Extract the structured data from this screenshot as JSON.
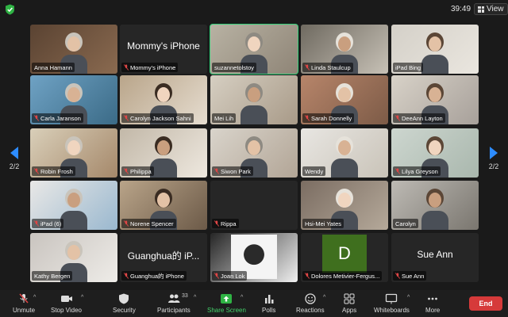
{
  "topbar": {
    "clock": "39:49",
    "view_label": "View"
  },
  "pager": {
    "left_page": "2/2",
    "right_page": "2/2"
  },
  "tiles": [
    {
      "name": "Anna Hamann",
      "muted": false
    },
    {
      "name": "Mommy's iPhone",
      "muted": true,
      "big_text": "Mommy's iPhone"
    },
    {
      "name": "suzannetolstoy",
      "muted": false,
      "active": true
    },
    {
      "name": "Linda Staulcup",
      "muted": true
    },
    {
      "name": "iPad Bing",
      "muted": false
    },
    {
      "name": "Carla Jaranson",
      "muted": true
    },
    {
      "name": "Carolyn Jackson Sahni",
      "muted": true
    },
    {
      "name": "Mei Lih",
      "muted": false
    },
    {
      "name": "Sarah Donnelly",
      "muted": true
    },
    {
      "name": "DeeAnn Layton",
      "muted": true
    },
    {
      "name": "Robin Frosh",
      "muted": true
    },
    {
      "name": "Philippa",
      "muted": true
    },
    {
      "name": "Siwon Park",
      "muted": true
    },
    {
      "name": "Wendy",
      "muted": false
    },
    {
      "name": "Lilya Greyson",
      "muted": true
    },
    {
      "name": "iPad (6)",
      "muted": true
    },
    {
      "name": "Norene Spencer",
      "muted": true
    },
    {
      "name": "Rippa",
      "muted": true
    },
    {
      "name": "Hsi-Mei Yates",
      "muted": false
    },
    {
      "name": "Carolyn",
      "muted": false
    },
    {
      "name": "Kathy Bergen",
      "muted": false
    },
    {
      "name": "Guanghua的 iPhone",
      "muted": true,
      "big_text": "Guanghua的 iP..."
    },
    {
      "name": "Joan Lok",
      "muted": true
    },
    {
      "name": "Dolores Metivier-Fergus...",
      "muted": true,
      "letter": "D"
    },
    {
      "name": "Sue Ann",
      "muted": true,
      "big_text": "Sue Ann"
    }
  ],
  "toolbar": {
    "unmute": "Unmute",
    "stop_video": "Stop Video",
    "security": "Security",
    "participants": "Participants",
    "participants_count": "33",
    "share_screen": "Share Screen",
    "polls": "Polls",
    "reactions": "Reactions",
    "apps": "Apps",
    "whiteboards": "Whiteboards",
    "more": "More",
    "end": "End"
  },
  "colors": {
    "accent_blue": "#2d8cff",
    "share_green": "#44d16b",
    "end_red": "#d63a3a",
    "active_speaker": "#33d17a"
  }
}
